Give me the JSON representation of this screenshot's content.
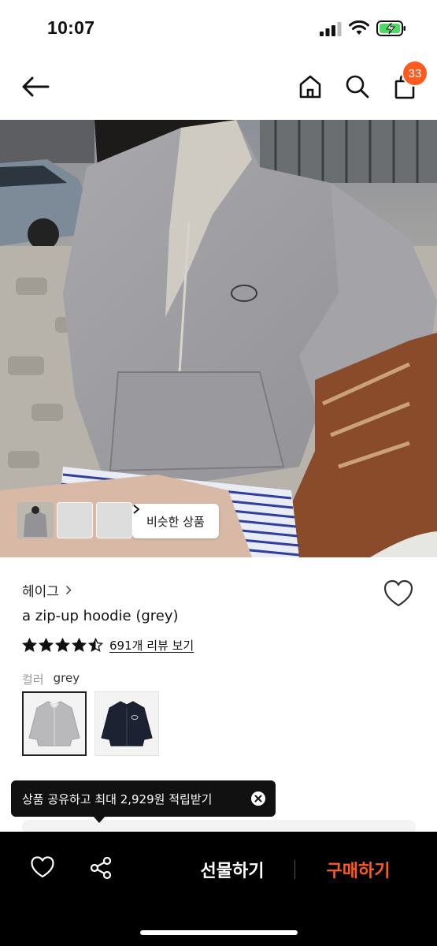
{
  "status": {
    "time": "10:07"
  },
  "nav": {
    "back_icon": "arrow-left-icon",
    "home_icon": "home-icon",
    "search_icon": "search-icon",
    "bag_icon": "shopping-bag-icon",
    "bag_count": "33"
  },
  "hero": {
    "similar_label": "비슷한 상품"
  },
  "product": {
    "brand": "헤이그",
    "name": "a zip-up hoodie (grey)",
    "rating": 4.5,
    "review_link": "691개 리뷰 보기",
    "option_label": "컬러",
    "option_value": "grey",
    "swatches": [
      "grey",
      "navy"
    ]
  },
  "tooltip": {
    "text": "상품 공유하고 최대 2,929원 적립받기"
  },
  "bottom_bar": {
    "gift_label": "선물하기",
    "buy_label": "구매하기"
  },
  "colors": {
    "accent": "#ff5a1f",
    "bar_bg": "#000000"
  }
}
